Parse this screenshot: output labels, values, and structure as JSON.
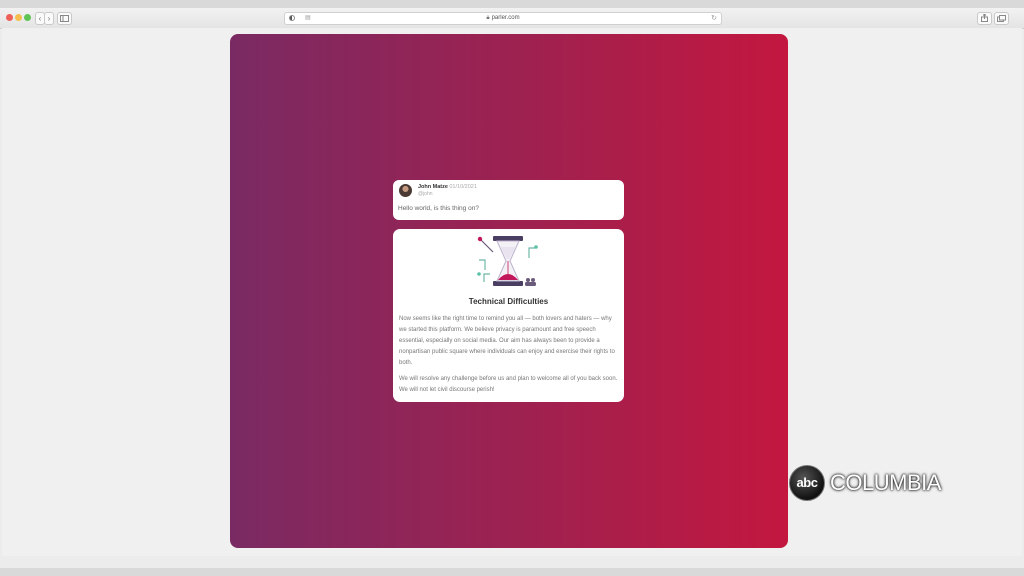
{
  "browser": {
    "url": "parler.com",
    "nav_back": "‹",
    "nav_forward": "›",
    "sidebar_icon": "sidebar-icon",
    "share_icon": "share-icon",
    "tabs_icon": "tabs-icon"
  },
  "post": {
    "author": "John Matze",
    "date": "· 01/10/2021",
    "handle": "@john",
    "text": "Hello world, is this thing on?"
  },
  "notice": {
    "icon": "hourglass-illustration",
    "title": "Technical Difficulties",
    "paragraphs": [
      "Now seems like the right time to remind you all — both lovers and haters — why we started this platform. We believe privacy is paramount and free speech essential, especially on social media. Our aim has always been to provide a nonpartisan public square where individuals can enjoy and exercise their rights to both.",
      "We will resolve any challenge before us and plan to welcome all of you back soon. We will not let civil discourse perish!"
    ]
  },
  "watermark": {
    "network": "abc",
    "station": "COLUMBIA"
  },
  "colors": {
    "gradient_start": "#7a2a63",
    "gradient_end": "#c3173f",
    "accent": "#a0214f"
  }
}
